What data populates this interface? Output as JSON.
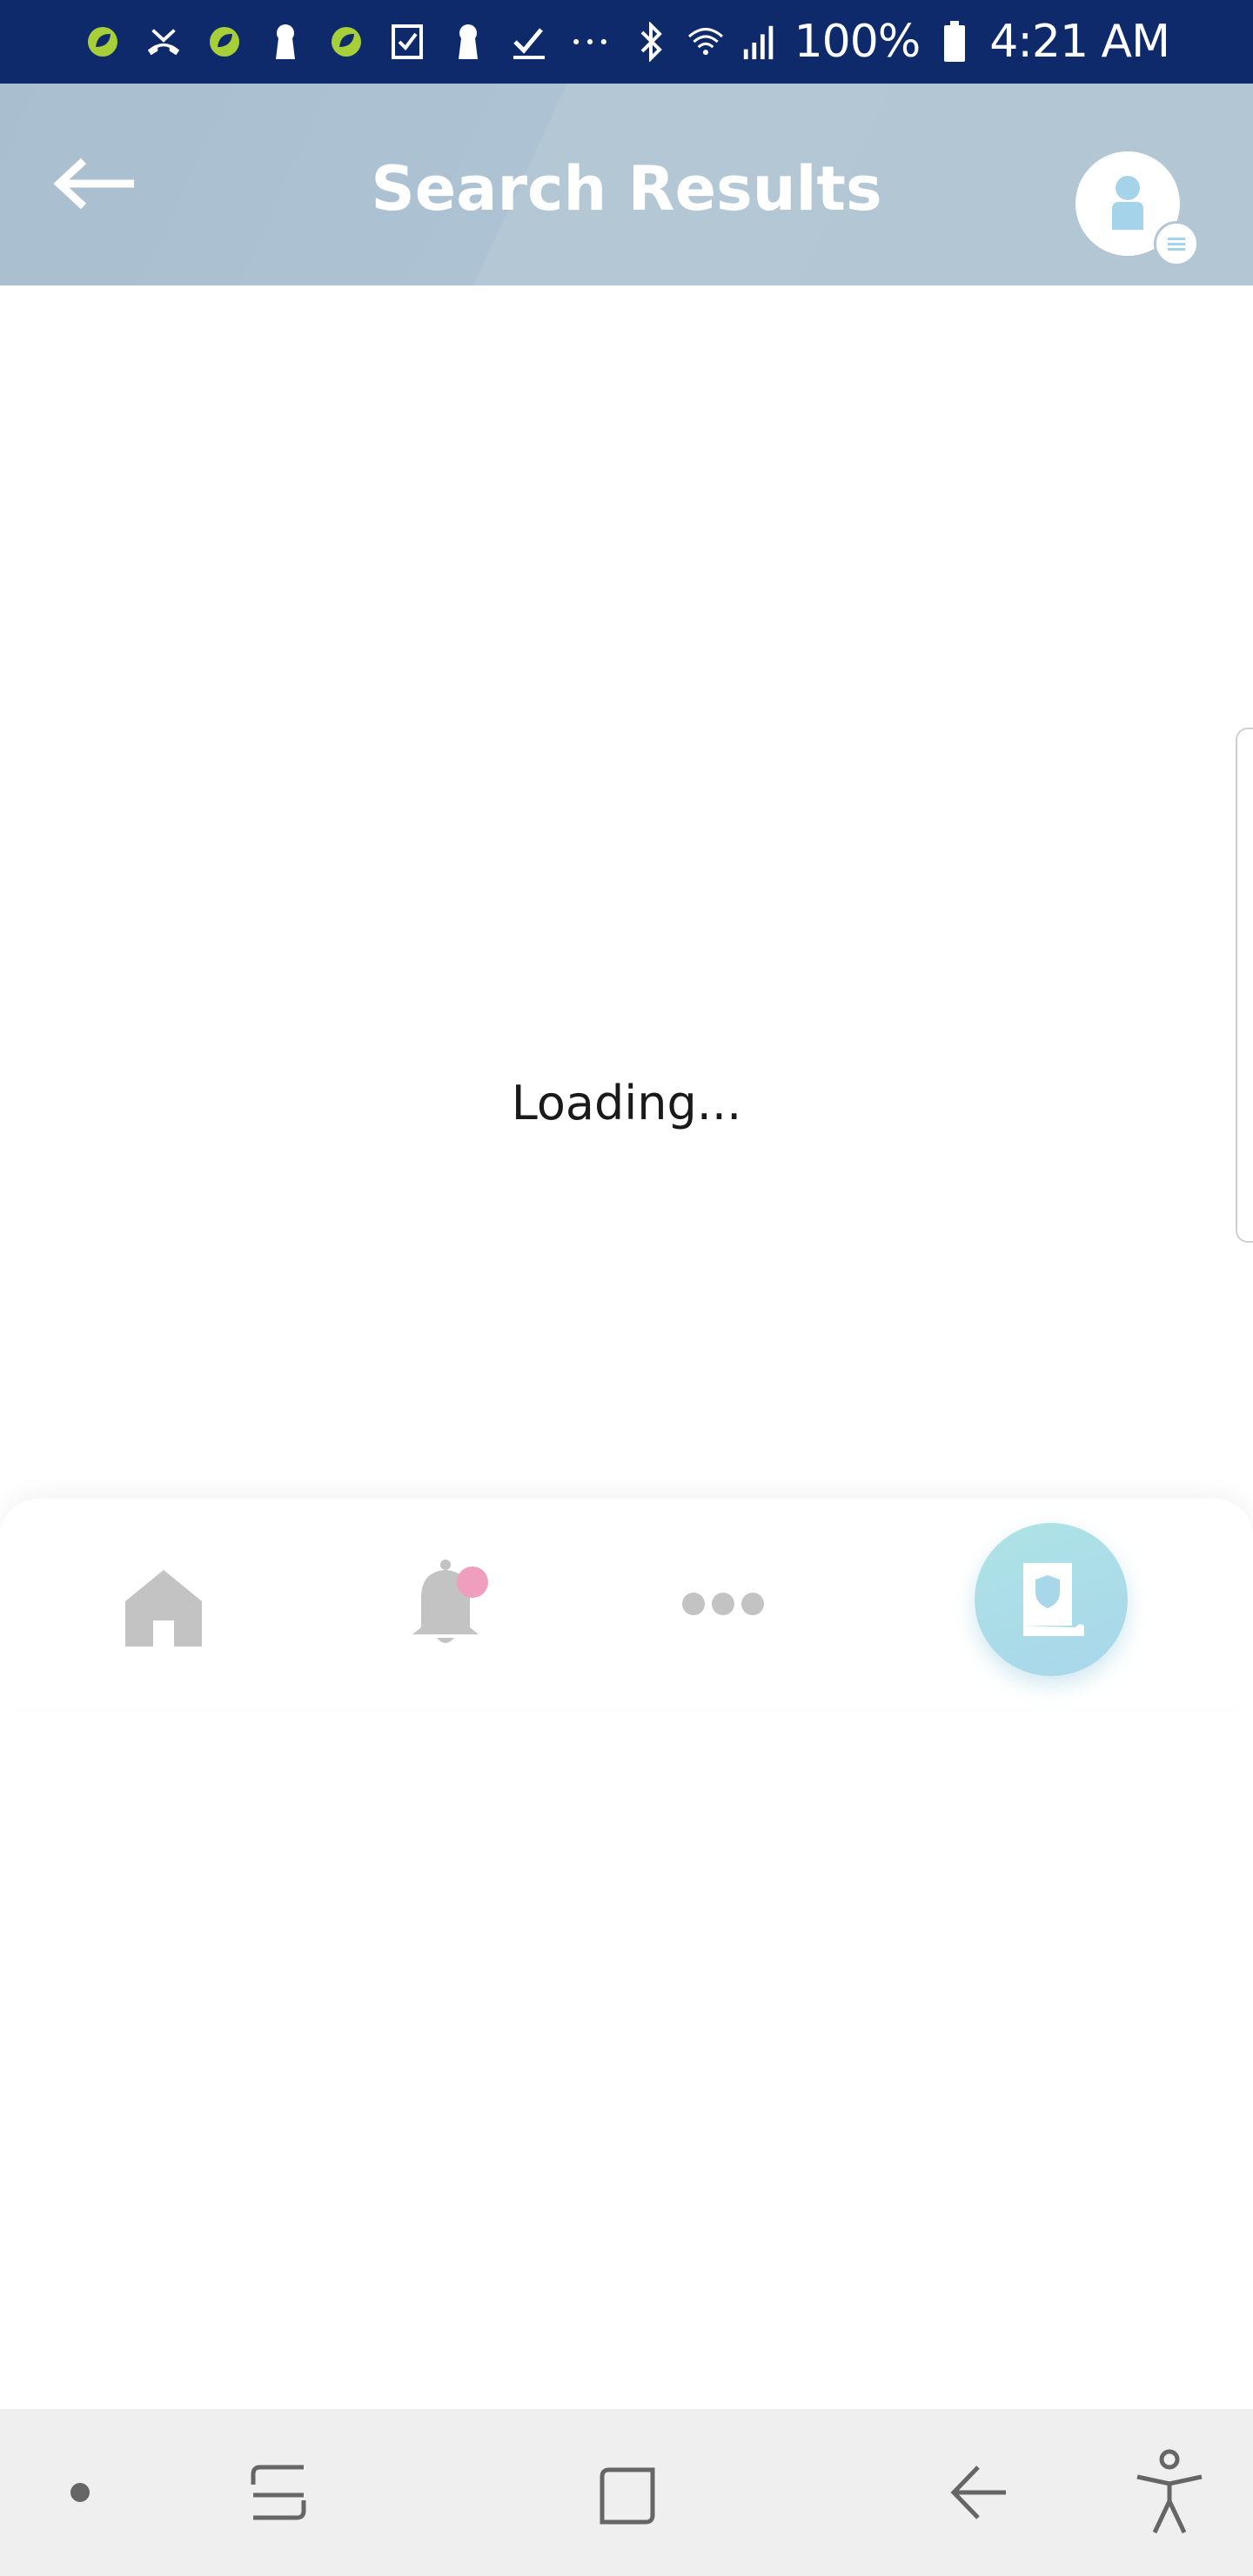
{
  "status_bar": {
    "battery": "100%",
    "time": "4:21 AM",
    "icons": [
      "leaf-app-icon",
      "missed-call-icon",
      "leaf-app-icon",
      "keyhole-icon",
      "leaf-app-icon",
      "checkbox-icon",
      "keyhole-icon",
      "checkmark-icon",
      "more-dots-icon",
      "bluetooth-icon",
      "wifi-icon",
      "signal-icon",
      "battery-icon"
    ]
  },
  "header": {
    "title": "Search Results",
    "back_icon": "arrow-left-icon",
    "avatar_icon": "user-avatar-icon",
    "avatar_menu_icon": "menu-lines-icon"
  },
  "content": {
    "loading_text": "Loading..."
  },
  "bottom_nav": {
    "items": [
      {
        "icon": "home-icon"
      },
      {
        "icon": "bell-icon",
        "has_badge": true
      },
      {
        "icon": "more-dots-icon"
      },
      {
        "icon": "policy-document-icon",
        "active": true
      }
    ],
    "colors": {
      "inactive": "#c3c3c3",
      "badge": "#ef9ebd",
      "active_bg": "#aee3e6"
    }
  },
  "system_nav": {
    "buttons": [
      "dot-icon",
      "recent-apps-icon",
      "home-square-icon",
      "back-arrow-icon",
      "accessibility-icon"
    ]
  },
  "colors": {
    "status_bar": "#0e2a6b",
    "header": "#b2c6d4"
  }
}
